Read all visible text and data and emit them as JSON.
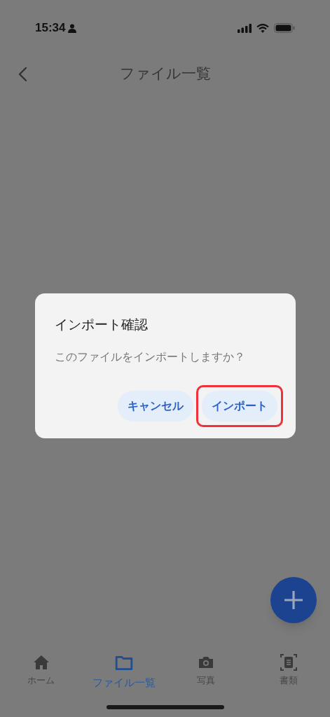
{
  "status_bar": {
    "time": "15:34"
  },
  "header": {
    "title": "ファイル一覧"
  },
  "dialog": {
    "title": "インポート確認",
    "message": "このファイルをインポートしますか？",
    "buttons": [
      {
        "label": "キャンセル",
        "highlighted": false
      },
      {
        "label": "インポート",
        "highlighted": true
      }
    ]
  },
  "tab_bar": [
    {
      "label": "ホーム",
      "selected": false
    },
    {
      "label": "ファイル一覧",
      "selected": true
    },
    {
      "label": "写真",
      "selected": false
    },
    {
      "label": "書類",
      "selected": false
    }
  ]
}
